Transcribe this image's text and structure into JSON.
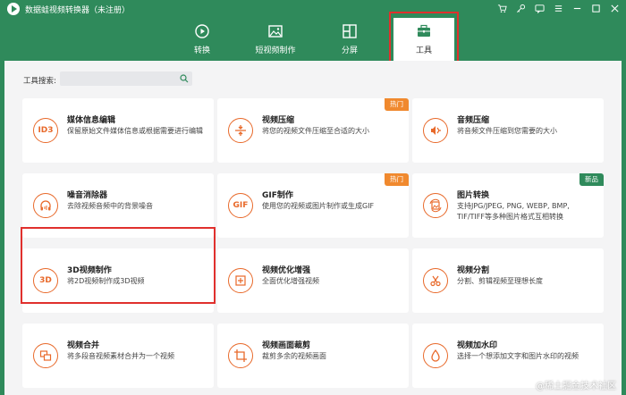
{
  "app": {
    "title": "数据蛙视频转换器（未注册）"
  },
  "tabs": [
    {
      "label": "转换",
      "icon": "convert-icon"
    },
    {
      "label": "短视频制作",
      "icon": "image-icon"
    },
    {
      "label": "分屏",
      "icon": "split-screen-icon"
    },
    {
      "label": "工具",
      "icon": "toolbox-icon",
      "active": true
    }
  ],
  "search": {
    "label": "工具搜索:",
    "placeholder": ""
  },
  "cards": [
    {
      "title": "媒体信息编辑",
      "desc": "保留原始文件媒体信息或根据需要进行编辑",
      "icon": "ID3",
      "badge": ""
    },
    {
      "title": "视频压缩",
      "desc": "将您的视频文件压缩至合适的大小",
      "icon": "compress-icon",
      "badge": "热门"
    },
    {
      "title": "音频压缩",
      "desc": "将音频文件压缩到您需要的大小",
      "icon": "audio-compress-icon",
      "badge": ""
    },
    {
      "title": "噪音消除器",
      "desc": "去除视频音频中的背景噪音",
      "icon": "noise-remover-icon",
      "badge": ""
    },
    {
      "title": "GIF制作",
      "desc": "使用您的视频或图片制作或生成GIF",
      "icon": "GIF",
      "badge": "热门"
    },
    {
      "title": "图片转换",
      "desc": "支持JPG/JPEG, PNG, WEBP, BMP, TIF/TIFF等多种图片格式互相转换",
      "icon": "image-convert-icon",
      "badge": "新品"
    },
    {
      "title": "3D视频制作",
      "desc": "将2D视频制作成3D视频",
      "icon": "3D",
      "badge": ""
    },
    {
      "title": "视频优化增强",
      "desc": "全面优化增强视频",
      "icon": "enhance-icon",
      "badge": ""
    },
    {
      "title": "视频分割",
      "desc": "分割、剪辑视频至理想长度",
      "icon": "scissors-icon",
      "badge": ""
    },
    {
      "title": "视频合并",
      "desc": "将多段音视频素材合并为一个视频",
      "icon": "merge-icon",
      "badge": ""
    },
    {
      "title": "视频画面裁剪",
      "desc": "裁剪多余的视频画面",
      "icon": "crop-icon",
      "badge": ""
    },
    {
      "title": "视频加水印",
      "desc": "选择一个想添加文字和图片水印的视频",
      "icon": "watermark-icon",
      "badge": ""
    }
  ],
  "watermark": "@稀土掘金技术社区",
  "colors": {
    "brand": "#2f8a5b",
    "accent": "#e8692a",
    "hot": "#f0892e",
    "highlight": "#e0302d"
  }
}
